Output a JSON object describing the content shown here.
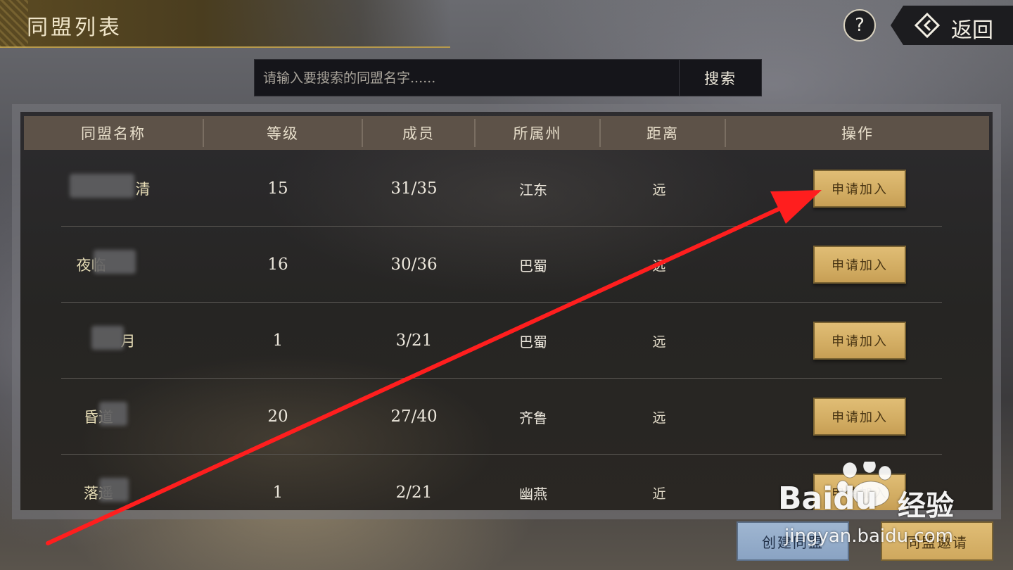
{
  "header": {
    "title": "同盟列表",
    "help_label": "?",
    "back_label": "返回"
  },
  "search": {
    "placeholder": "请输入要搜索的同盟名字......",
    "button_label": "搜索"
  },
  "table": {
    "columns": [
      "同盟名称",
      "等级",
      "成员",
      "所属州",
      "距离",
      "操作"
    ],
    "join_label": "申请加入",
    "rows": [
      {
        "name": "清",
        "level": "15",
        "members": "31/35",
        "state": "江东",
        "distance": "远"
      },
      {
        "name": "夜临",
        "level": "16",
        "members": "30/36",
        "state": "巴蜀",
        "distance": "远"
      },
      {
        "name": "月",
        "level": "1",
        "members": "3/21",
        "state": "巴蜀",
        "distance": "远"
      },
      {
        "name": "昏道",
        "level": "20",
        "members": "27/40",
        "state": "齐鲁",
        "distance": "远"
      },
      {
        "name": "落遥",
        "level": "1",
        "members": "2/21",
        "state": "幽燕",
        "distance": "近"
      }
    ]
  },
  "footer": {
    "create_label": "创建同盟",
    "invite_label": "同盟邀请"
  },
  "watermark": {
    "brand": "Baidu",
    "jingyan": "经验",
    "site": "jingyan.baidu.com"
  },
  "annotation": {
    "arrow_color": "#ff1e1e"
  }
}
